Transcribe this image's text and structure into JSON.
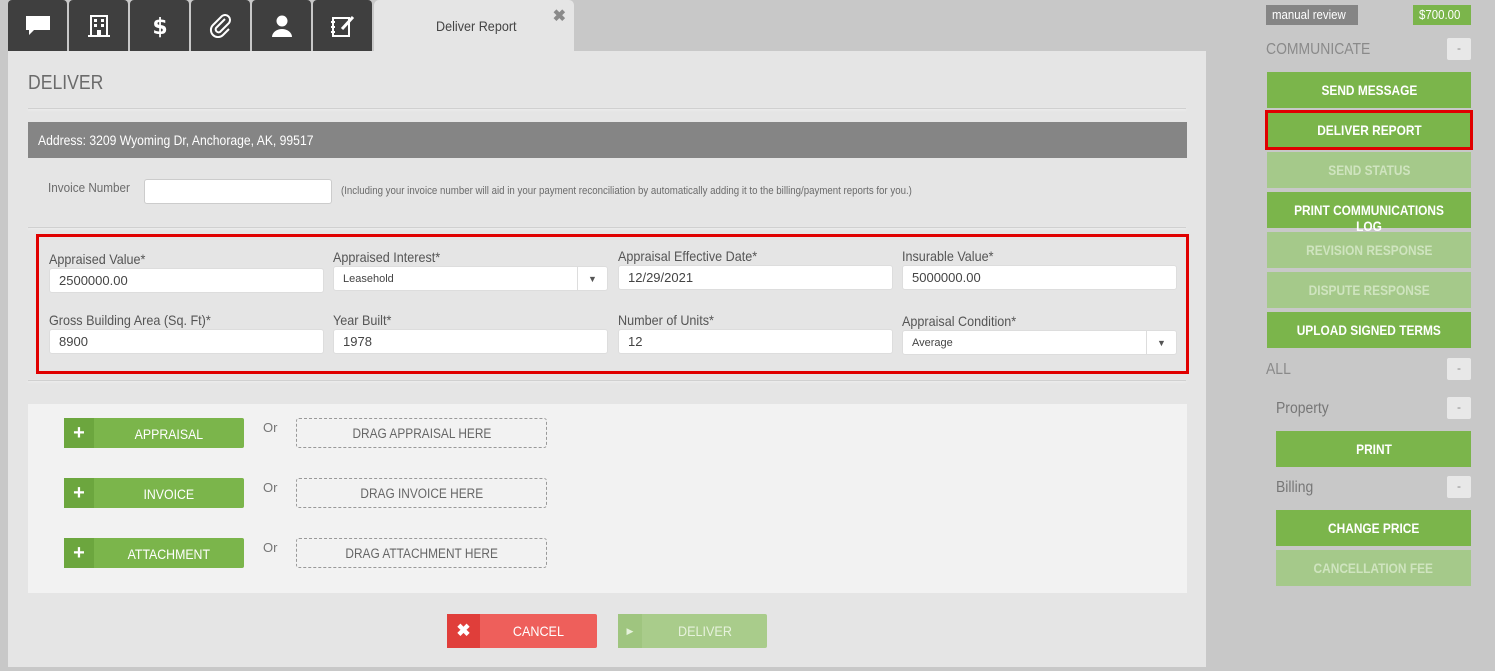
{
  "tabs": {
    "icons": [
      "chat-icon",
      "building-icon",
      "dollar-icon",
      "paperclip-icon",
      "user-icon",
      "notepad-icon"
    ],
    "active_label": "Deliver Report"
  },
  "page": {
    "title": "DELIVER",
    "address": "Address: 3209 Wyoming Dr, Anchorage, AK, 99517",
    "invoice_label": "Invoice Number",
    "invoice_value": "",
    "invoice_note": "(Including your invoice number will aid in your payment reconciliation by automatically adding it to the billing/payment reports for you.)"
  },
  "fields": {
    "appraised_value": {
      "label": "Appraised Value*",
      "value": "2500000.00"
    },
    "appraised_interest": {
      "label": "Appraised Interest*",
      "value": "Leasehold"
    },
    "effective_date": {
      "label": "Appraisal Effective Date*",
      "value": "12/29/2021"
    },
    "insurable_value": {
      "label": "Insurable Value*",
      "value": "5000000.00"
    },
    "gross_area": {
      "label": "Gross Building Area (Sq. Ft)*",
      "value": "8900"
    },
    "year_built": {
      "label": "Year Built*",
      "value": "1978"
    },
    "units": {
      "label": "Number of Units*",
      "value": "12"
    },
    "condition": {
      "label": "Appraisal Condition*",
      "value": "Average"
    }
  },
  "uploads": {
    "or": "Or",
    "appraisal": {
      "button": "APPRAISAL",
      "drop": "DRAG APPRAISAL HERE"
    },
    "invoice": {
      "button": "INVOICE",
      "drop": "DRAG INVOICE HERE"
    },
    "attachment": {
      "button": "ATTACHMENT",
      "drop": "DRAG ATTACHMENT HERE"
    }
  },
  "actions": {
    "cancel": "CANCEL",
    "deliver": "DELIVER"
  },
  "sidebar": {
    "status": "manual review",
    "price": "$700.00",
    "communicate": "COMMUNICATE",
    "collapse": "-",
    "send_message": "SEND MESSAGE",
    "deliver_report": "DELIVER REPORT",
    "send_status": "SEND STATUS",
    "print_log": "PRINT COMMUNICATIONS LOG",
    "revision_response": "REVISION RESPONSE",
    "dispute_response": "DISPUTE RESPONSE",
    "upload_terms": "UPLOAD SIGNED TERMS",
    "all": "ALL",
    "property": "Property",
    "print": "PRINT",
    "billing": "Billing",
    "change_price": "CHANGE PRICE",
    "cancellation_fee": "CANCELLATION FEE"
  },
  "colors": {
    "green": "#7bb54b",
    "red": "#ee5f5b",
    "highlight": "#e00000",
    "gray": "#858585"
  }
}
